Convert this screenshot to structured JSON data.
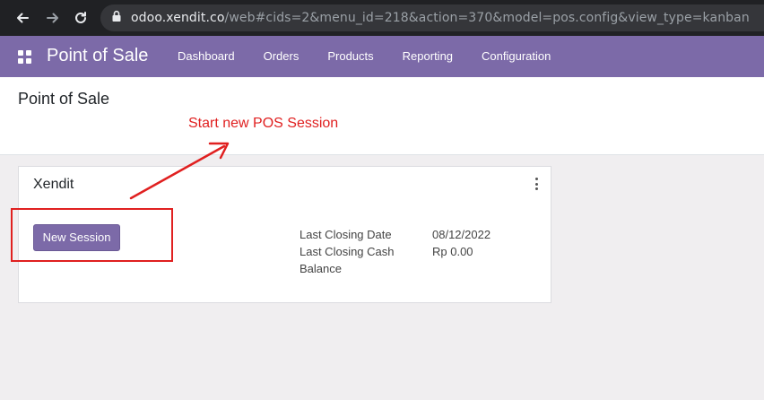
{
  "browser": {
    "url_host": "odoo.xendit.co",
    "url_path": "/web#cids=2&menu_id=218&action=370&model=pos.config&view_type=kanban"
  },
  "navbar": {
    "brand": "Point of Sale",
    "menu": [
      "Dashboard",
      "Orders",
      "Products",
      "Reporting",
      "Configuration"
    ]
  },
  "control_panel": {
    "breadcrumb": "Point of Sale"
  },
  "kanban": {
    "card_title": "Xendit",
    "new_session_label": "New Session",
    "info": [
      {
        "label": "Last Closing Date",
        "value": "08/12/2022"
      },
      {
        "label": "Last Closing Cash",
        "value": "Rp 0.00"
      },
      {
        "label": "Balance",
        "value": ""
      }
    ]
  },
  "annotation": {
    "text": "Start new POS Session",
    "color": "#e02020"
  },
  "colors": {
    "navbar": "#7c6aa8",
    "button": "#7c6aa8",
    "browser_bar": "#202124"
  }
}
